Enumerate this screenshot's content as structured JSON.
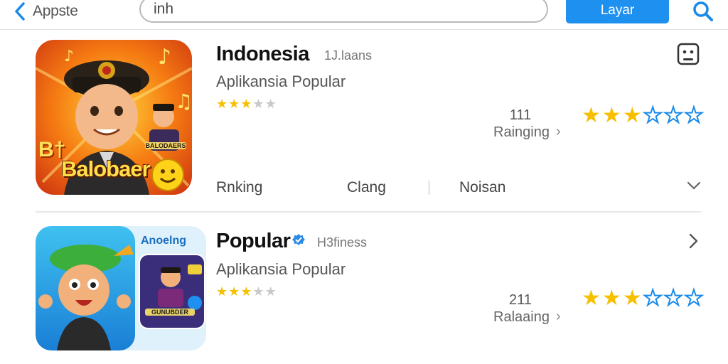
{
  "header": {
    "back_label": "Appste",
    "search_value": "inh",
    "primary_button": "Layar",
    "icons": {
      "back": "chevron-left-icon",
      "search": "search-icon"
    },
    "accent_color": "#1e90f0"
  },
  "apps": [
    {
      "name": "Indonesia",
      "meta": "1J.laans",
      "subtitle": "Aplikansia Popular",
      "small_rating": 3,
      "small_rating_max": 5,
      "count": "111",
      "rating_label": "Rainging",
      "big_rating": 3,
      "big_rating_max": 6,
      "icon_text": "Balobaer",
      "icon_badge": "B†",
      "icon_side_text": "BALODAERS",
      "tabs": [
        "Rnking",
        "Clang",
        "Noisan"
      ],
      "icons": {
        "corner": "widget-face-icon",
        "expand": "chevron-down-icon"
      }
    },
    {
      "name": "Popular",
      "meta": "H3finess",
      "subtitle": "Aplikansia Popular",
      "small_rating": 3,
      "small_rating_max": 5,
      "count": "211",
      "rating_label": "Ralaaing",
      "big_rating": 3,
      "big_rating_max": 6,
      "icon_text": "Anoelng",
      "icon_side_text": "GUNUBDER",
      "icons": {
        "verified": "verified-badge-icon",
        "open": "chevron-right-icon"
      }
    }
  ],
  "colors": {
    "star_filled": "#f6c000",
    "star_empty_outline": "#1a8ae8",
    "star_empty_small": "#c8c8c8"
  }
}
